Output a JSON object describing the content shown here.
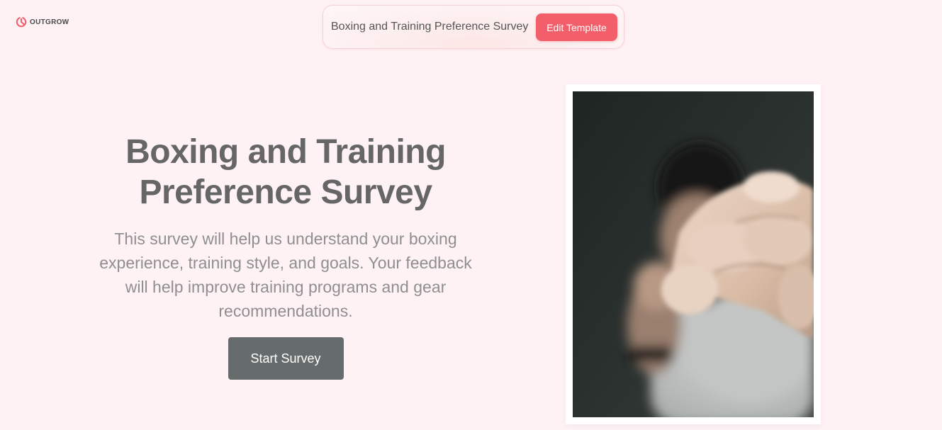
{
  "brand": {
    "name": "OUTGROW",
    "icon": "outgrow-logo-icon",
    "accent_color": "#f25f6a"
  },
  "topbar": {
    "title": "Boxing and Training Preference Survey",
    "edit_button_label": "Edit Template"
  },
  "hero": {
    "title": "Boxing and Training Preference Survey",
    "description": "This survey will help us understand your boxing experience, training style, and goals. Your feedback will help improve training programs and gear recommendations.",
    "start_button_label": "Start Survey",
    "button_color": "#666c6b"
  },
  "image": {
    "subject": "person-punching-fist-photo"
  },
  "colors": {
    "background": "#fff2f5",
    "title_text": "#666666",
    "body_text": "#8f8f8f"
  }
}
